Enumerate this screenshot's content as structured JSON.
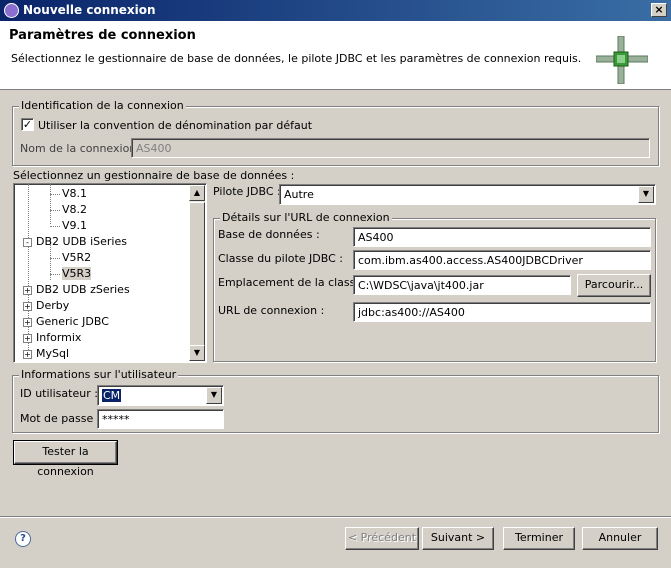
{
  "window": {
    "title": "Nouvelle connexion"
  },
  "header": {
    "title": "Paramètres de connexion",
    "description": "Sélectionnez le gestionnaire de base de données, le pilote JDBC et les paramètres de connexion requis."
  },
  "identification": {
    "group_label": "Identification de la connexion",
    "use_default_label": "Utiliser la convention de dénomination par défaut",
    "use_default_checked": true,
    "name_label": "Nom de la connexion :",
    "name_value": "AS400"
  },
  "db_manager": {
    "label": "Sélectionnez un gestionnaire de base de données :",
    "tree": [
      {
        "label": "V8.1",
        "level": 2,
        "expander": ""
      },
      {
        "label": "V8.2",
        "level": 2,
        "expander": ""
      },
      {
        "label": "V9.1",
        "level": 2,
        "expander": ""
      },
      {
        "label": "DB2 UDB iSeries",
        "level": 1,
        "expander": "-"
      },
      {
        "label": "V5R2",
        "level": 2,
        "expander": ""
      },
      {
        "label": "V5R3",
        "level": 2,
        "expander": "",
        "selected": true
      },
      {
        "label": "DB2 UDB zSeries",
        "level": 1,
        "expander": "+"
      },
      {
        "label": "Derby",
        "level": 1,
        "expander": "+"
      },
      {
        "label": "Generic JDBC",
        "level": 1,
        "expander": "+"
      },
      {
        "label": "Informix",
        "level": 1,
        "expander": "+"
      },
      {
        "label": "MySql",
        "level": 1,
        "expander": "+"
      }
    ]
  },
  "jdbc": {
    "driver_label": "Pilote JDBC :",
    "driver_value": "Autre",
    "url_group_label": "Détails sur l'URL de connexion",
    "database_label": "Base de données :",
    "database_value": "AS400",
    "driver_class_label": "Classe du pilote JDBC :",
    "driver_class_value": "com.ibm.as400.access.AS400JDBCDriver",
    "class_location_label": "Emplacement de la classe :",
    "class_location_value": "C:\\WDSC\\java\\jt400.jar",
    "browse_label": "Parcourir...",
    "url_label": "URL de connexion :",
    "url_value": "jdbc:as400://AS400"
  },
  "user": {
    "group_label": "Informations sur l'utilisateur",
    "id_label": "ID utilisateur :",
    "id_value": "CM",
    "password_label": "Mot de passe :",
    "password_value": "*****"
  },
  "buttons": {
    "test": "Tester la connexion",
    "previous": "< Précédent",
    "next": "Suivant >",
    "finish": "Terminer",
    "cancel": "Annuler"
  },
  "colors": {
    "title_bar": "#0a246a",
    "selection": "#0a246a",
    "dialog_bg": "#d4d0c8"
  }
}
